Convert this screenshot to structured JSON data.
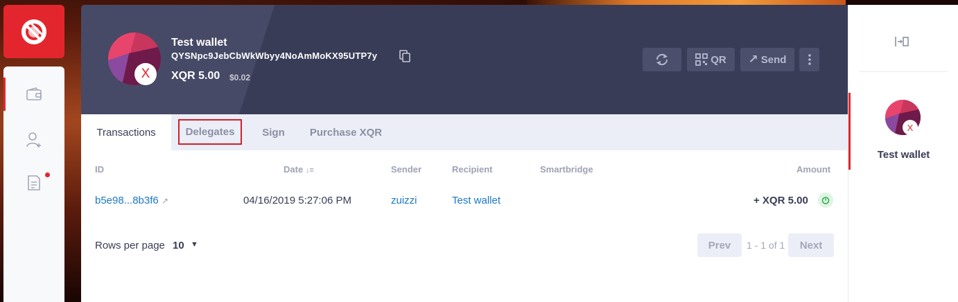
{
  "header": {
    "wallet_name": "Test wallet",
    "address": "QYSNpc9JebCbWkWbyy4NoAmMoKX95UTP7y",
    "balance": "XQR 5.00",
    "fiat": "$0.02",
    "avatar_badge": "X",
    "buttons": {
      "refresh_icon": "refresh-icon",
      "qr_label": "QR",
      "send_label": "Send",
      "more_icon": "more-vertical-icon"
    }
  },
  "tabs": [
    "Transactions",
    "Delegates",
    "Sign",
    "Purchase XQR"
  ],
  "table": {
    "columns": [
      "ID",
      "Date",
      "Sender",
      "Recipient",
      "Smartbridge",
      "Amount"
    ],
    "rows": [
      {
        "id": "b5e98...8b3f6",
        "date": "04/16/2019 5:27:06 PM",
        "sender": "zuizzi",
        "recipient": "Test wallet",
        "smartbridge": "",
        "amount": "+ XQR 5.00"
      }
    ]
  },
  "pagination": {
    "rows_label": "Rows per page",
    "rows_value": "10",
    "prev": "Prev",
    "info": "1 - 1 of 1",
    "next": "Next"
  },
  "sidebar_right": {
    "wallet_name": "Test wallet",
    "avatar_badge": "X"
  },
  "colors": {
    "accent": "#e3262d",
    "header": "#393c56",
    "link": "#1b78c9"
  }
}
